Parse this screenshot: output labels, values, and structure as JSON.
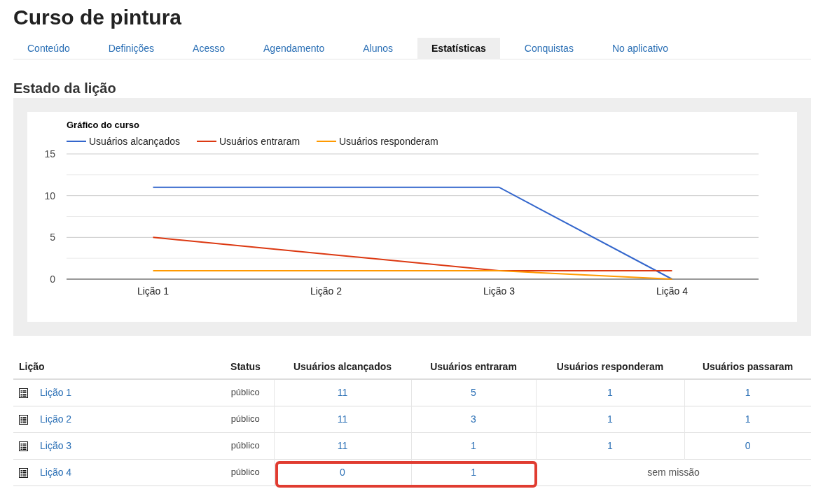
{
  "page_title": "Curso de pintura",
  "tabs": [
    {
      "label": "Conteúdo",
      "selected": false
    },
    {
      "label": "Definições",
      "selected": false
    },
    {
      "label": "Acesso",
      "selected": false
    },
    {
      "label": "Agendamento",
      "selected": false
    },
    {
      "label": "Alunos",
      "selected": false
    },
    {
      "label": "Estatísticas",
      "selected": true
    },
    {
      "label": "Conquistas",
      "selected": false
    },
    {
      "label": "No aplicativo",
      "selected": false
    }
  ],
  "section_title": "Estado da lição",
  "chart": {
    "chart_data": {
      "type": "line",
      "title": "Gráfico do curso",
      "legend": "top",
      "categories": [
        "Lição 1",
        "Lição 2",
        "Lição 3",
        "Lição 4"
      ],
      "ylim": [
        0,
        15
      ],
      "yticks": [
        0,
        5,
        10,
        15
      ],
      "series": [
        {
          "name": "Usuários alcançados",
          "color": "#3366cc",
          "values": [
            11,
            11,
            11,
            0
          ]
        },
        {
          "name": "Usuários entraram",
          "color": "#dc3912",
          "values": [
            5,
            3,
            1,
            1
          ]
        },
        {
          "name": "Usuários responderam",
          "color": "#ff9900",
          "values": [
            1,
            1,
            1,
            0
          ]
        }
      ]
    }
  },
  "table": {
    "columns": [
      "Lição",
      "Status",
      "Usuários alcançados",
      "Usuários entraram",
      "Usuários responderam",
      "Usuários passaram"
    ],
    "rows": [
      {
        "kind": "counts",
        "lesson": "Lição 1",
        "status": "público",
        "reached": "11",
        "entered": "5",
        "responded": "1",
        "passed": "1",
        "highlighted": false
      },
      {
        "kind": "counts",
        "lesson": "Lição 2",
        "status": "público",
        "reached": "11",
        "entered": "3",
        "responded": "1",
        "passed": "1",
        "highlighted": false
      },
      {
        "kind": "counts",
        "lesson": "Lição 3",
        "status": "público",
        "reached": "11",
        "entered": "1",
        "responded": "1",
        "passed": "0",
        "highlighted": false
      },
      {
        "kind": "no_mission",
        "lesson": "Lição 4",
        "status": "público",
        "reached": "0",
        "entered": "1",
        "note": "sem missão",
        "highlighted": true
      }
    ]
  }
}
